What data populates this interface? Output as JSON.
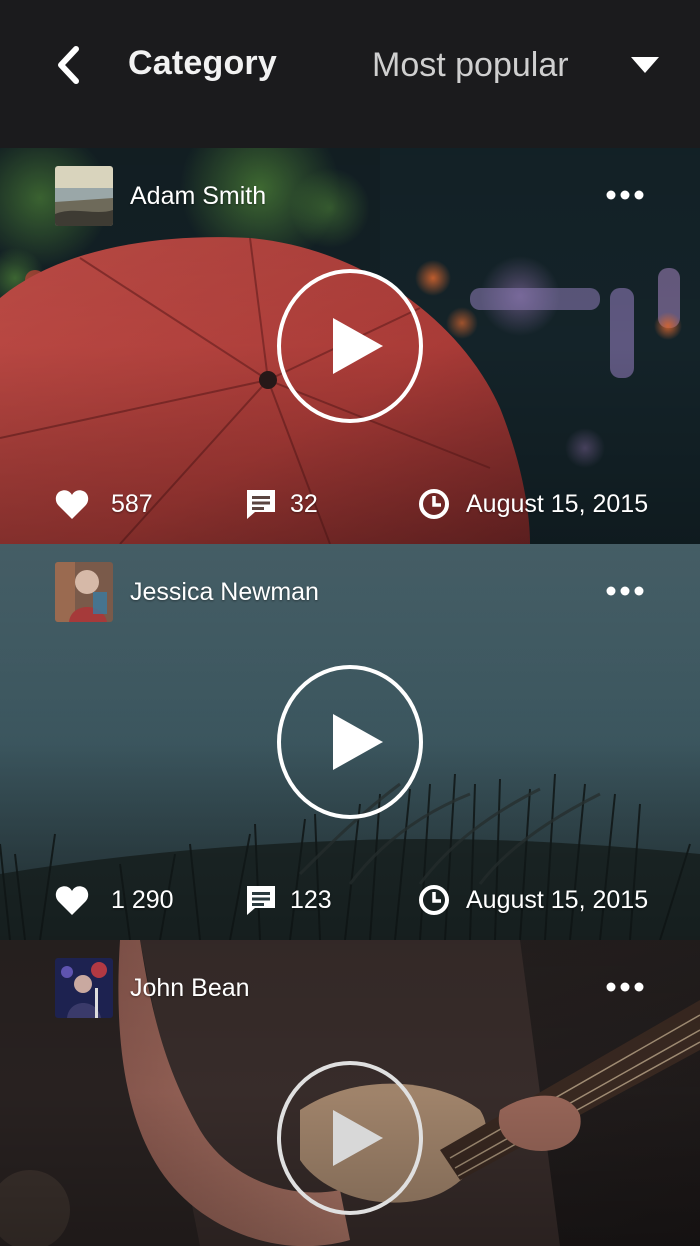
{
  "header": {
    "title": "Category",
    "sort_label": "Most popular"
  },
  "posts": [
    {
      "author": "Adam Smith",
      "likes": "587",
      "comments": "32",
      "date": "August 15, 2015"
    },
    {
      "author": "Jessica Newman",
      "likes": "1 290",
      "comments": "123",
      "date": "August 15, 2015"
    },
    {
      "author": "John Bean"
    }
  ],
  "icons": {
    "back": "chevron-left-icon",
    "sort": "caret-down-icon",
    "more": "more-horizontal-icon",
    "play": "play-icon",
    "likes": "heart-icon",
    "comments": "comment-icon",
    "date": "clock-icon"
  },
  "colors": {
    "header_bg": "#1b1b1d",
    "text": "#ffffff",
    "sort_text": "#cfcfcf"
  }
}
